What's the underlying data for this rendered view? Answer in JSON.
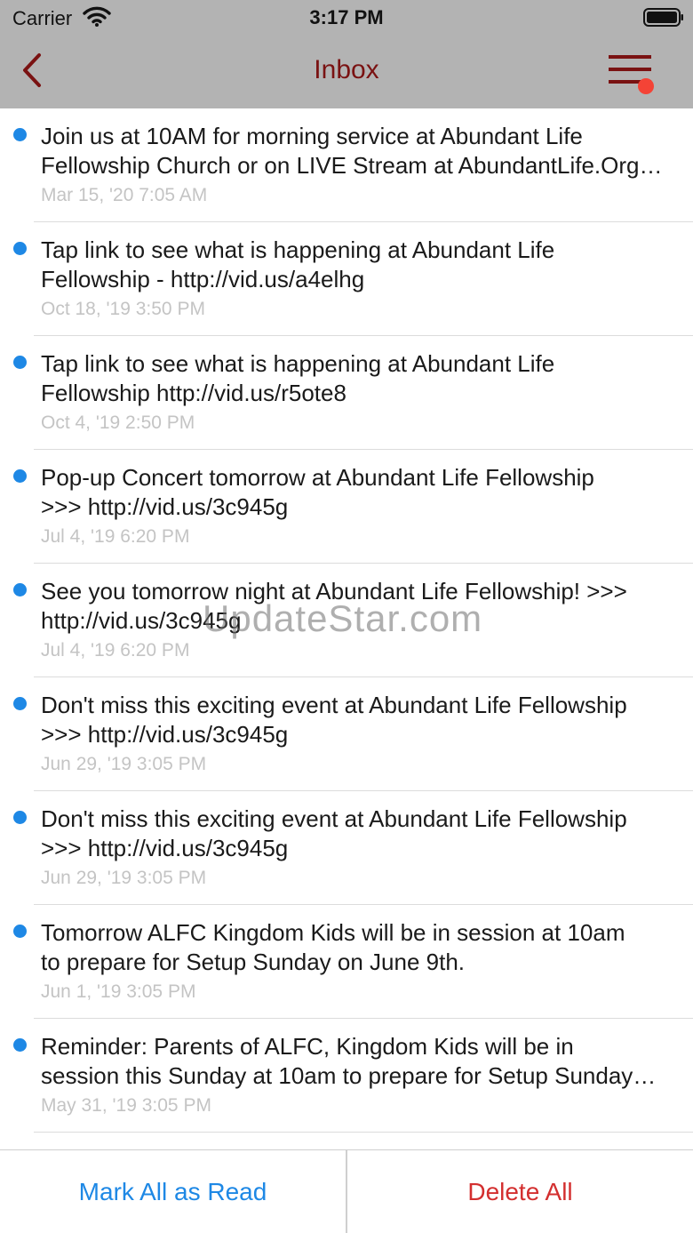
{
  "status_bar": {
    "carrier": "Carrier",
    "time": "3:17 PM"
  },
  "nav": {
    "title": "Inbox"
  },
  "messages": [
    {
      "line1": "Join us at 10AM for morning service at Abundant Life",
      "line2": "Fellowship Church or on LIVE Stream at AbundantLife.Org…",
      "date": "Mar 15, '20 7:05 AM"
    },
    {
      "line1": "Tap link to see what is happening at Abundant Life",
      "line2": "Fellowship - http://vid.us/a4elhg",
      "date": "Oct 18, '19 3:50 PM"
    },
    {
      "line1": "Tap link to see what is happening at Abundant Life",
      "line2": "Fellowship http://vid.us/r5ote8",
      "date": "Oct 4, '19 2:50 PM"
    },
    {
      "line1": "Pop-up Concert tomorrow at Abundant Life Fellowship",
      "line2": ">>> http://vid.us/3c945g",
      "date": "Jul 4, '19 6:20 PM"
    },
    {
      "line1": "See you tomorrow night at Abundant Life Fellowship! >>>",
      "line2": "http://vid.us/3c945g",
      "date": "Jul 4, '19 6:20 PM"
    },
    {
      "line1": "Don't miss this exciting event at Abundant Life Fellowship",
      "line2": ">>> http://vid.us/3c945g",
      "date": "Jun 29, '19 3:05 PM"
    },
    {
      "line1": "Don't miss this exciting event at Abundant Life Fellowship",
      "line2": ">>> http://vid.us/3c945g",
      "date": "Jun 29, '19 3:05 PM"
    },
    {
      "line1": "Tomorrow ALFC Kingdom Kids will be in session at 10am",
      "line2": "to prepare for Setup Sunday on June 9th.",
      "date": "Jun 1, '19 3:05 PM"
    },
    {
      "line1": "Reminder: Parents of ALFC, Kingdom Kids will be in",
      "line2": "session this Sunday at 10am to prepare for Setup Sunday…",
      "date": "May 31, '19 3:05 PM"
    }
  ],
  "watermark": "UpdateStar.com",
  "actions": {
    "mark_all_read": "Mark All as Read",
    "delete_all": "Delete All"
  },
  "colors": {
    "nav_bg": "#b3b3b3",
    "title": "#7a1212",
    "unread_dot": "#1e88e5",
    "menu_badge": "#f44336",
    "mark_read": "#1e88e5",
    "delete": "#d32f2f"
  }
}
